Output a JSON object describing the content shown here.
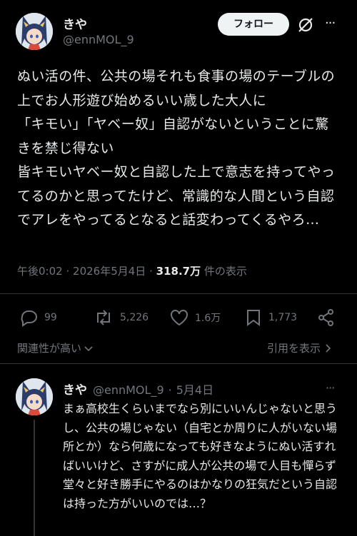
{
  "post": {
    "author_name": "きや",
    "author_handle": "@ennMOL_9",
    "follow_label": "フォロー",
    "more_label": "···",
    "body": "ぬい活の件、公共の場それも食事の場のテーブルの上でお人形遊び始めるいい歳した大人に\n「キモい」「ヤベー奴」自認がないということに驚きを禁じ得ない\n皆キモいヤベー奴と自認した上で意志を持ってやってるのかと思ってたけど、常識的な人間という自認でアレをやってるとなると話変わってくるやろ…",
    "time": "午後0:02",
    "date": "2026年5月4日",
    "sep": "·",
    "views_count": "318.7万",
    "views_label": "件の表示",
    "replies": "99",
    "reposts": "5,226",
    "likes": "1.6万",
    "bookmarks": "1,773"
  },
  "sort": {
    "relevance_label": "関連性が高い",
    "quotes_label": "引用を表示"
  },
  "reply": {
    "author_name": "きや",
    "author_handle": "@ennMOL_9",
    "sep": "·",
    "date": "5月4日",
    "more_label": "···",
    "body": "まぁ高校生くらいまでなら別にいいんじゃないと思うし、公共の場じゃない（自宅とか周りに人がいない場所とか）なら何歳になっても好きなようにぬい活すればいいけど、さすがに成人が公共の場で人目も憚らず堂々と好き勝手にやるのはかなりの狂気だという自認は持った方がいいのでは…？"
  },
  "colors": {
    "background": "#000000",
    "text": "#e7e9ea",
    "secondary": "#71767b",
    "divider": "#2f3336",
    "button_bg": "#eff3f4"
  }
}
